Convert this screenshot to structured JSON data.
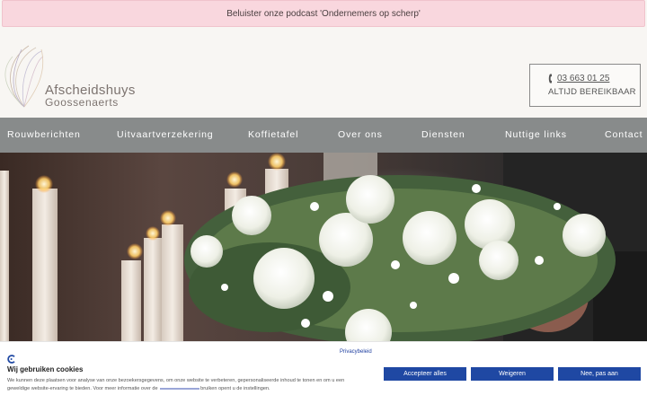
{
  "banner": {
    "text": "Beluister onze podcast 'Ondernemers op scherp'"
  },
  "brand": {
    "line1": "Afscheidshuys",
    "line2": "Goossenaerts"
  },
  "contact": {
    "phone": "03 663 01 25",
    "availability": "ALTIJD BEREIKBAAR"
  },
  "nav": {
    "items": [
      {
        "label": "Rouwberichten"
      },
      {
        "label": "Uitvaartverzekering"
      },
      {
        "label": "Koffietafel"
      },
      {
        "label": "Over ons"
      },
      {
        "label": "Diensten"
      },
      {
        "label": "Nuttige links"
      },
      {
        "label": "Contact"
      }
    ]
  },
  "cookie": {
    "privacy_link": "Privacybeleid",
    "title": "Wij gebruiken cookies",
    "text_part1": "We kunnen deze plaatsen voor analyse van onze bezoekersgegevens, om onze website te verbeteren, gepersonaliseerde inhoud te tonen en om u een geweldige website-ervaring te bieden. Voor meer informatie over de",
    "text_part2": "bruiken opent u de instellingen.",
    "accept_label": "Accepteer alles",
    "refuse_label": "Weigeren",
    "customize_label": "Nee, pas aan"
  },
  "colors": {
    "nav_bg": "#888b8b",
    "banner_bg": "#f9d7de",
    "button_bg": "#1f48a3"
  }
}
